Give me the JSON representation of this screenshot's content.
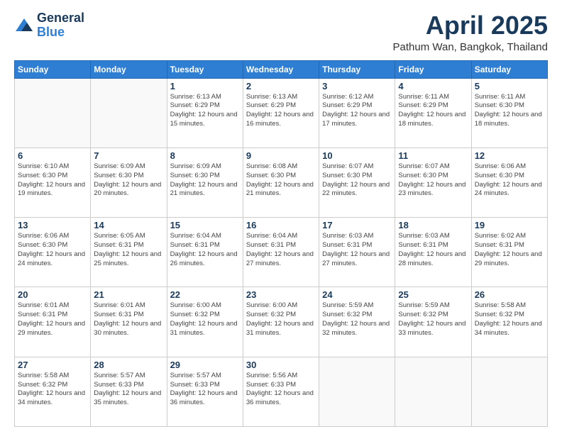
{
  "header": {
    "logo_general": "General",
    "logo_blue": "Blue",
    "month_title": "April 2025",
    "location": "Pathum Wan, Bangkok, Thailand"
  },
  "days_of_week": [
    "Sunday",
    "Monday",
    "Tuesday",
    "Wednesday",
    "Thursday",
    "Friday",
    "Saturday"
  ],
  "weeks": [
    [
      {
        "day": "",
        "info": ""
      },
      {
        "day": "",
        "info": ""
      },
      {
        "day": "1",
        "info": "Sunrise: 6:13 AM\nSunset: 6:29 PM\nDaylight: 12 hours and 15 minutes."
      },
      {
        "day": "2",
        "info": "Sunrise: 6:13 AM\nSunset: 6:29 PM\nDaylight: 12 hours and 16 minutes."
      },
      {
        "day": "3",
        "info": "Sunrise: 6:12 AM\nSunset: 6:29 PM\nDaylight: 12 hours and 17 minutes."
      },
      {
        "day": "4",
        "info": "Sunrise: 6:11 AM\nSunset: 6:29 PM\nDaylight: 12 hours and 18 minutes."
      },
      {
        "day": "5",
        "info": "Sunrise: 6:11 AM\nSunset: 6:30 PM\nDaylight: 12 hours and 18 minutes."
      }
    ],
    [
      {
        "day": "6",
        "info": "Sunrise: 6:10 AM\nSunset: 6:30 PM\nDaylight: 12 hours and 19 minutes."
      },
      {
        "day": "7",
        "info": "Sunrise: 6:09 AM\nSunset: 6:30 PM\nDaylight: 12 hours and 20 minutes."
      },
      {
        "day": "8",
        "info": "Sunrise: 6:09 AM\nSunset: 6:30 PM\nDaylight: 12 hours and 21 minutes."
      },
      {
        "day": "9",
        "info": "Sunrise: 6:08 AM\nSunset: 6:30 PM\nDaylight: 12 hours and 21 minutes."
      },
      {
        "day": "10",
        "info": "Sunrise: 6:07 AM\nSunset: 6:30 PM\nDaylight: 12 hours and 22 minutes."
      },
      {
        "day": "11",
        "info": "Sunrise: 6:07 AM\nSunset: 6:30 PM\nDaylight: 12 hours and 23 minutes."
      },
      {
        "day": "12",
        "info": "Sunrise: 6:06 AM\nSunset: 6:30 PM\nDaylight: 12 hours and 24 minutes."
      }
    ],
    [
      {
        "day": "13",
        "info": "Sunrise: 6:06 AM\nSunset: 6:30 PM\nDaylight: 12 hours and 24 minutes."
      },
      {
        "day": "14",
        "info": "Sunrise: 6:05 AM\nSunset: 6:31 PM\nDaylight: 12 hours and 25 minutes."
      },
      {
        "day": "15",
        "info": "Sunrise: 6:04 AM\nSunset: 6:31 PM\nDaylight: 12 hours and 26 minutes."
      },
      {
        "day": "16",
        "info": "Sunrise: 6:04 AM\nSunset: 6:31 PM\nDaylight: 12 hours and 27 minutes."
      },
      {
        "day": "17",
        "info": "Sunrise: 6:03 AM\nSunset: 6:31 PM\nDaylight: 12 hours and 27 minutes."
      },
      {
        "day": "18",
        "info": "Sunrise: 6:03 AM\nSunset: 6:31 PM\nDaylight: 12 hours and 28 minutes."
      },
      {
        "day": "19",
        "info": "Sunrise: 6:02 AM\nSunset: 6:31 PM\nDaylight: 12 hours and 29 minutes."
      }
    ],
    [
      {
        "day": "20",
        "info": "Sunrise: 6:01 AM\nSunset: 6:31 PM\nDaylight: 12 hours and 29 minutes."
      },
      {
        "day": "21",
        "info": "Sunrise: 6:01 AM\nSunset: 6:31 PM\nDaylight: 12 hours and 30 minutes."
      },
      {
        "day": "22",
        "info": "Sunrise: 6:00 AM\nSunset: 6:32 PM\nDaylight: 12 hours and 31 minutes."
      },
      {
        "day": "23",
        "info": "Sunrise: 6:00 AM\nSunset: 6:32 PM\nDaylight: 12 hours and 31 minutes."
      },
      {
        "day": "24",
        "info": "Sunrise: 5:59 AM\nSunset: 6:32 PM\nDaylight: 12 hours and 32 minutes."
      },
      {
        "day": "25",
        "info": "Sunrise: 5:59 AM\nSunset: 6:32 PM\nDaylight: 12 hours and 33 minutes."
      },
      {
        "day": "26",
        "info": "Sunrise: 5:58 AM\nSunset: 6:32 PM\nDaylight: 12 hours and 34 minutes."
      }
    ],
    [
      {
        "day": "27",
        "info": "Sunrise: 5:58 AM\nSunset: 6:32 PM\nDaylight: 12 hours and 34 minutes."
      },
      {
        "day": "28",
        "info": "Sunrise: 5:57 AM\nSunset: 6:33 PM\nDaylight: 12 hours and 35 minutes."
      },
      {
        "day": "29",
        "info": "Sunrise: 5:57 AM\nSunset: 6:33 PM\nDaylight: 12 hours and 36 minutes."
      },
      {
        "day": "30",
        "info": "Sunrise: 5:56 AM\nSunset: 6:33 PM\nDaylight: 12 hours and 36 minutes."
      },
      {
        "day": "",
        "info": ""
      },
      {
        "day": "",
        "info": ""
      },
      {
        "day": "",
        "info": ""
      }
    ]
  ]
}
